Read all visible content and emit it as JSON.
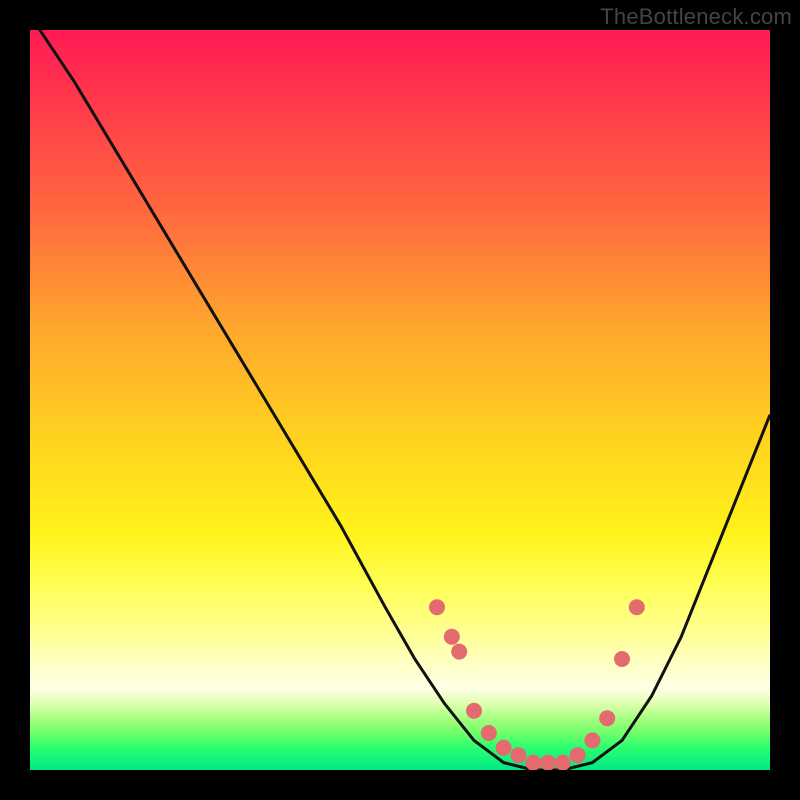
{
  "watermark": "TheBottleneck.com",
  "colors": {
    "frame": "#000000",
    "curve": "#111111",
    "marker": "#e46a6f"
  },
  "chart_data": {
    "type": "line",
    "title": "",
    "xlabel": "",
    "ylabel": "",
    "xlim": [
      0,
      100
    ],
    "ylim": [
      0,
      100
    ],
    "series": [
      {
        "name": "bottleneck-curve",
        "x": [
          0,
          6,
          12,
          18,
          24,
          30,
          36,
          42,
          48,
          52,
          56,
          60,
          64,
          68,
          72,
          76,
          80,
          84,
          88,
          92,
          96,
          100
        ],
        "y": [
          102,
          93,
          83,
          73,
          63,
          53,
          43,
          33,
          22,
          15,
          9,
          4,
          1,
          0,
          0,
          1,
          4,
          10,
          18,
          28,
          38,
          48
        ]
      }
    ],
    "markers": {
      "name": "highlighted-points",
      "x": [
        55,
        57,
        58,
        60,
        62,
        64,
        66,
        68,
        70,
        72,
        74,
        76,
        78,
        80,
        82
      ],
      "y": [
        22,
        18,
        16,
        8,
        5,
        3,
        2,
        1,
        1,
        1,
        2,
        4,
        7,
        15,
        22
      ]
    }
  }
}
